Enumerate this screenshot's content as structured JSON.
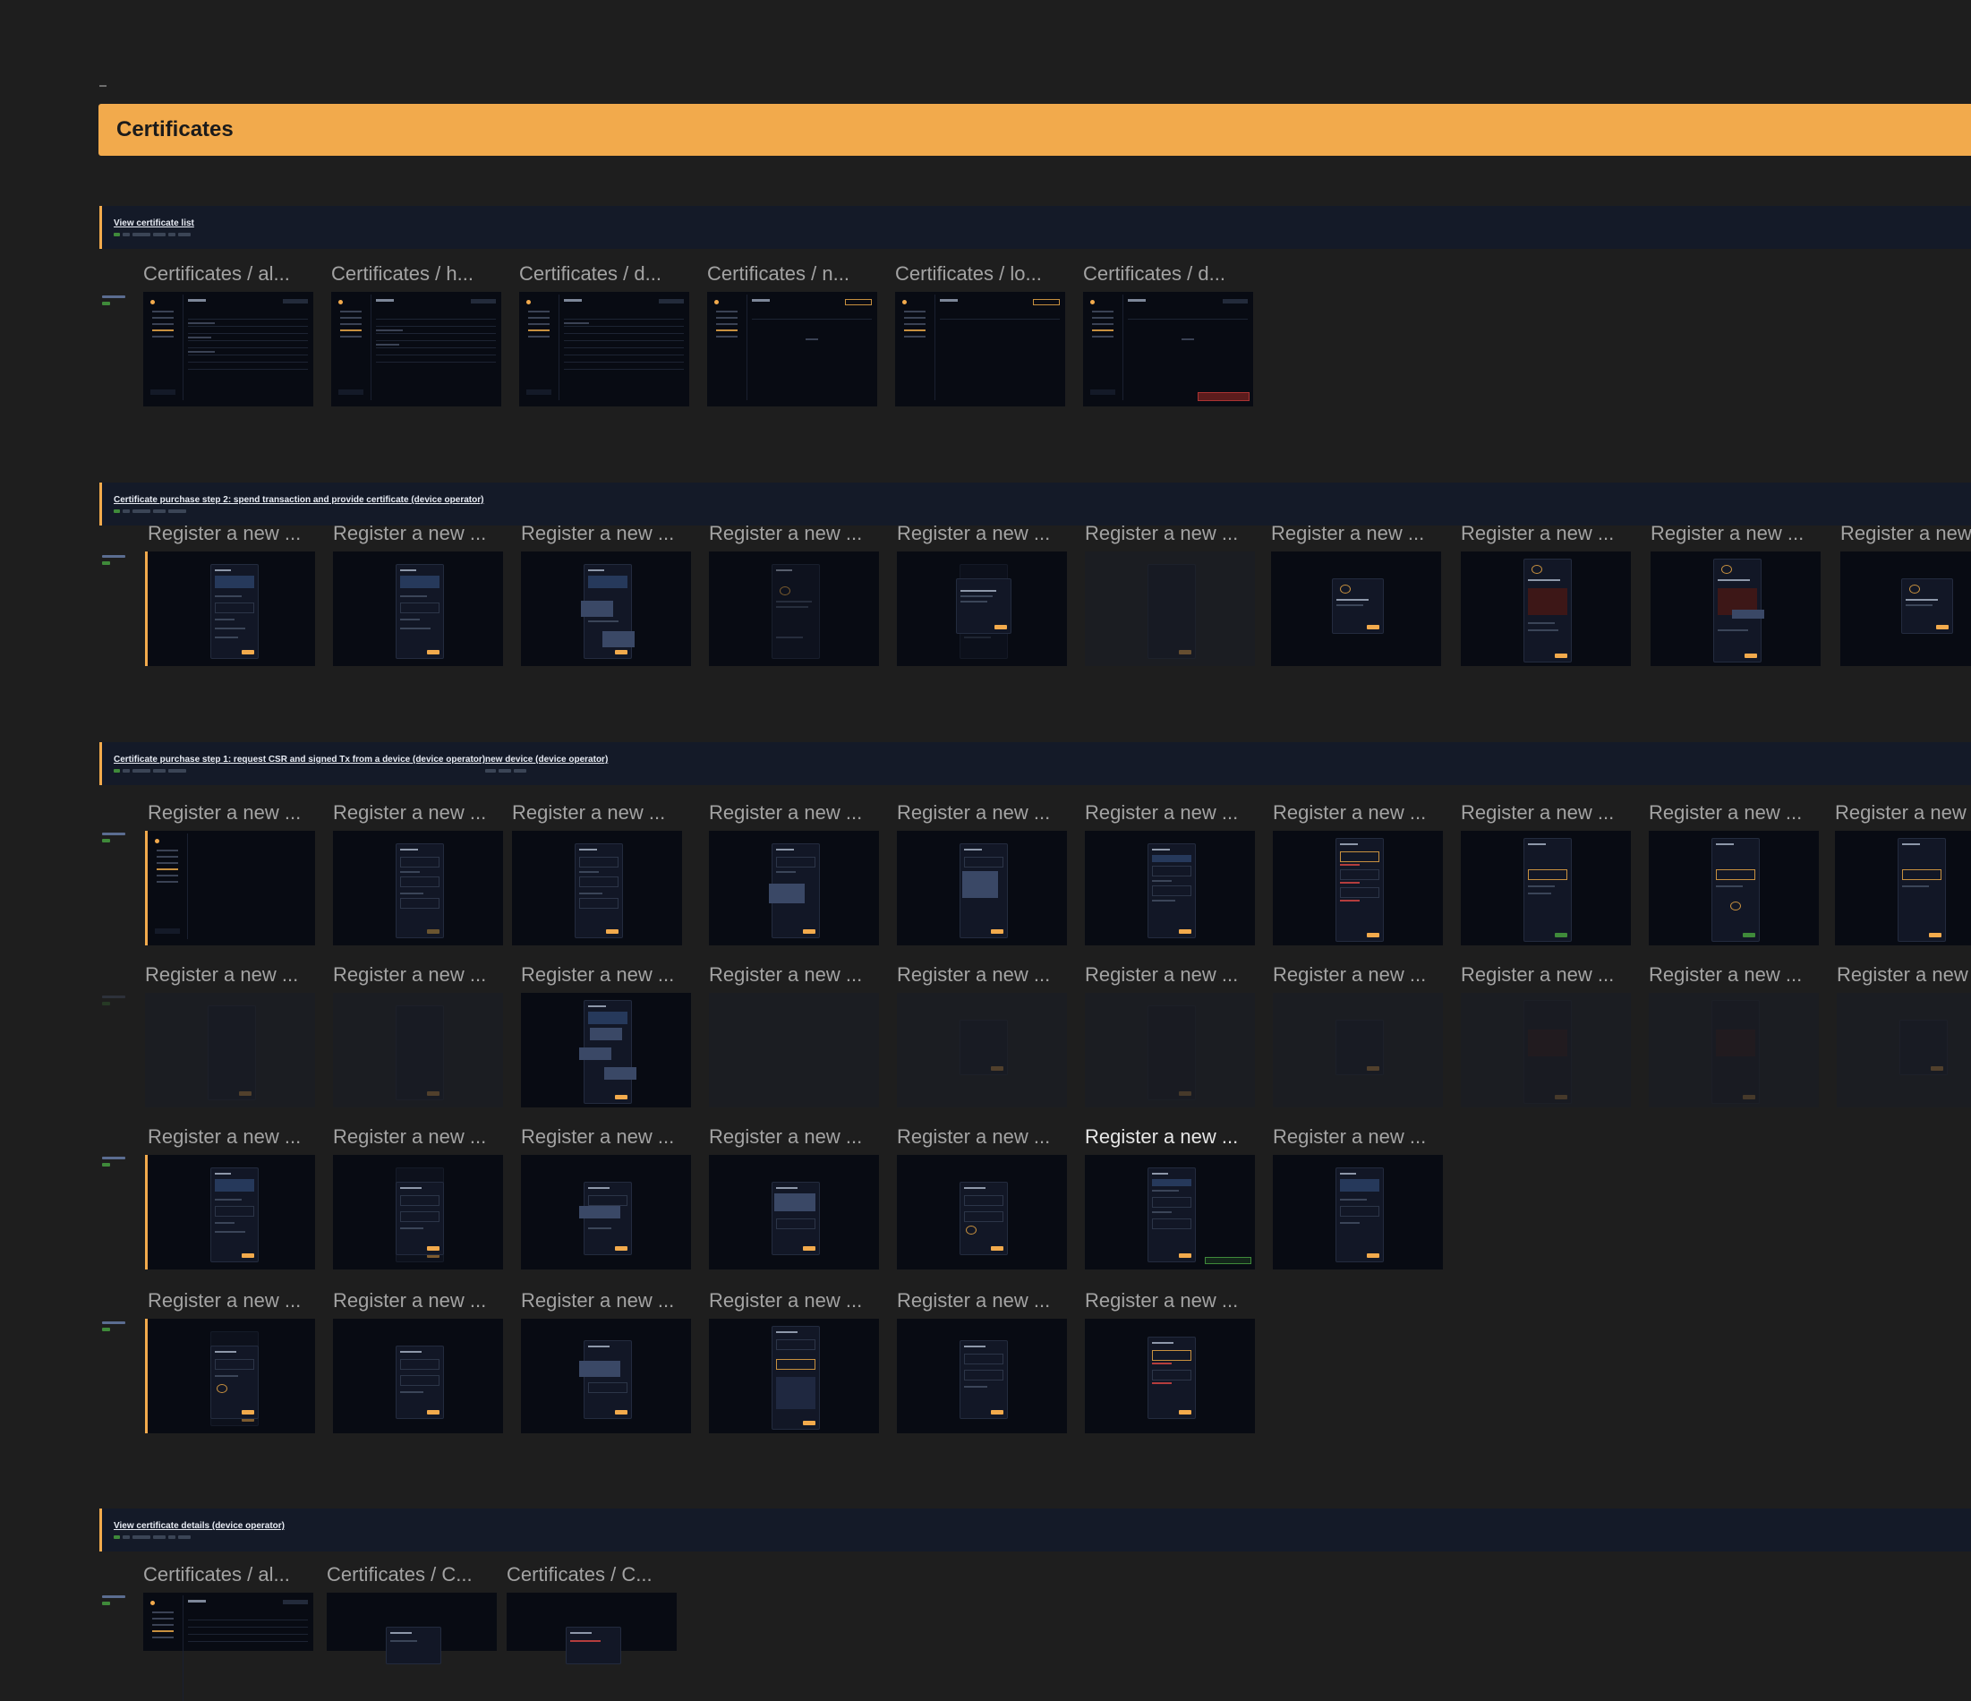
{
  "page": {
    "title": "Certificates"
  },
  "sections": [
    {
      "id": "view-list",
      "links": [
        "View certificate list"
      ]
    },
    {
      "id": "purchase-step-2",
      "links": [
        "Certificate purchase step 2: spend transaction and provide certificate (device operator)"
      ]
    },
    {
      "id": "purchase-step-1",
      "links": [
        "Certificate purchase step 1: request CSR and signed Tx from a device (device operator)",
        "new device (device operator)"
      ]
    },
    {
      "id": "view-details",
      "links": [
        "View certificate details (device operator)"
      ]
    }
  ],
  "frames": {
    "list": [
      "Certificates / al...",
      "Certificates / h...",
      "Certificates / d...",
      "Certificates / n...",
      "Certificates / lo...",
      "Certificates / d..."
    ],
    "step2": [
      "Register a new ...",
      "Register a new ...",
      "Register a new ...",
      "Register a new ...",
      "Register a new ...",
      "Register a new ...",
      "Register a new ...",
      "Register a new ...",
      "Register a new ...",
      "Register a new"
    ],
    "step1_row1": [
      "Register a new ...",
      "Register a new ...",
      "Register a new ...",
      "Register a new ...",
      "Register a new ...",
      "Register a new ...",
      "Register a new ...",
      "Register a new ...",
      "Register a new ...",
      "Register a new"
    ],
    "step1_row2": [
      "Register a new ...",
      "Register a new ...",
      "Register a new ...",
      "Register a new ...",
      "Register a new ...",
      "Register a new ...",
      "Register a new ...",
      "Register a new ...",
      "Register a new ...",
      "Register a new"
    ],
    "step1_row3": [
      "Register a new ...",
      "Register a new ...",
      "Register a new ...",
      "Register a new ...",
      "Register a new ...",
      "Register a new ...",
      "Register a new ..."
    ],
    "step1_row4": [
      "Register a new ...",
      "Register a new ...",
      "Register a new ...",
      "Register a new ...",
      "Register a new ...",
      "Register a new ..."
    ],
    "details": [
      "Certificates / al...",
      "Certificates / C...",
      "Certificates / C..."
    ]
  }
}
